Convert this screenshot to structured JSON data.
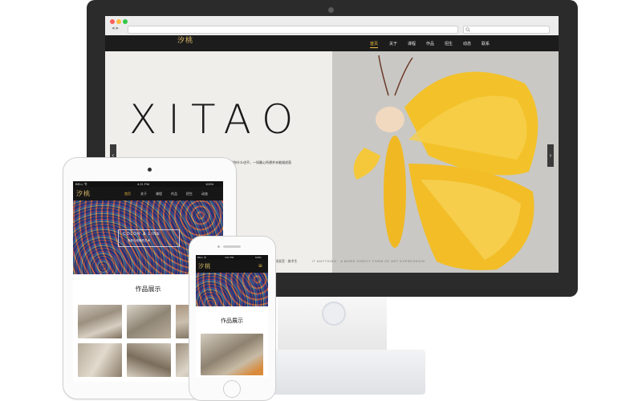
{
  "desktop": {
    "logo_text": "汐桃",
    "nav": [
      "首页",
      "关于",
      "课程",
      "作品",
      "招生",
      "动态",
      "联系"
    ],
    "active_nav": "首页",
    "hero": {
      "headline": "XITAO",
      "tagline": "都说你什么也不，一如最心所想并未能描述直",
      "caption_left": "汐桃画室 · 美术生",
      "caption_right": "IT ANYTHING · A MORE DIRECT FORM OF ART EXPRESSION",
      "arrow_left": "‹",
      "arrow_right": "›"
    }
  },
  "tablet": {
    "status_left": "BELL 令",
    "status_time": "4:21 PM",
    "status_right": "100%",
    "logo_text": "汐桃",
    "nav": [
      "首页",
      "关于",
      "课程",
      "作品",
      "招生",
      "动态"
    ],
    "banner_text": "COLOR & LINE",
    "banner_sub": "色彩与线条的艺术",
    "section_title": "作品展示"
  },
  "phone": {
    "status_left": "BELL 令",
    "status_time": "4:21 PM",
    "status_right": "100%",
    "logo_text": "汐桃",
    "menu_icon": "≡",
    "section_title": "作品展示"
  },
  "colors": {
    "accent": "#f0c040",
    "navbar": "#1c1c1c",
    "butterfly": "#f3c22a",
    "monitor": "#2b2b2b"
  },
  "icons": [
    "apple-logo-icon",
    "menu-icon",
    "search-icon",
    "chevron-left-icon",
    "chevron-right-icon"
  ]
}
